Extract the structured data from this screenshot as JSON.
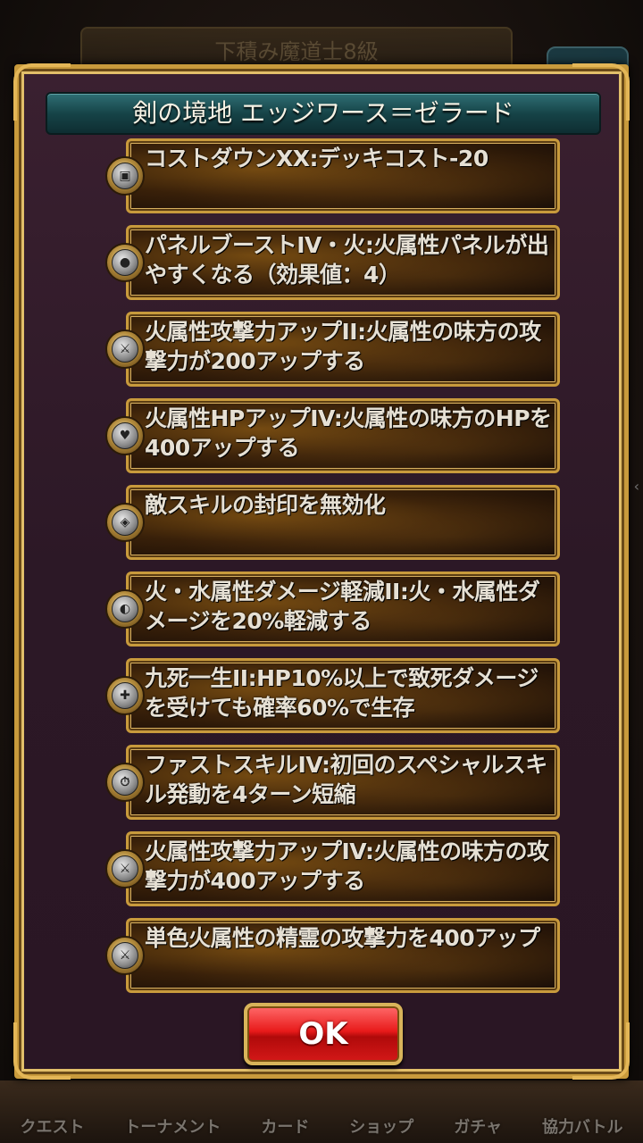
{
  "background": {
    "header_text": "下積み魔道士8級",
    "nav_items": [
      "クエスト",
      "トーナメント",
      "カード",
      "ショップ",
      "ガチャ",
      "協力バトル"
    ]
  },
  "modal": {
    "title": "剣の境地 エッジワース＝ゼラード",
    "skills": [
      {
        "text": "コストダウンXX:デッキコスト-20",
        "icon": "card-cost-icon"
      },
      {
        "text": "パネルブーストIV・火:火属性パネルが出やすくなる（効果値：4）",
        "icon": "panel-boost-icon"
      },
      {
        "text": "火属性攻撃力アップII:火属性の味方の攻撃力が200アップする",
        "icon": "sword-up-icon"
      },
      {
        "text": "火属性HPアップIV:火属性の味方のHPを400アップする",
        "icon": "heart-up-icon"
      },
      {
        "text": "敵スキルの封印を無効化",
        "icon": "seal-guard-icon"
      },
      {
        "text": "火・水属性ダメージ軽減II:火・水属性ダメージを20%軽減する",
        "icon": "shield-down-icon"
      },
      {
        "text": "九死一生II:HP10%以上で致死ダメージを受けても確率60%で生存",
        "icon": "survive-icon"
      },
      {
        "text": "ファストスキルIV:初回のスペシャルスキル発動を4ターン短縮",
        "icon": "fast-skill-icon"
      },
      {
        "text": "火属性攻撃力アップIV:火属性の味方の攻撃力が400アップする",
        "icon": "sword-up-icon"
      },
      {
        "text": "単色火属性の精霊の攻撃力を400アップ",
        "icon": "sword-up-icon"
      }
    ],
    "ok_label": "OK"
  },
  "colors": {
    "frame_gold": "#c89a3c",
    "title_teal": "#164448",
    "ok_red": "#e81a1a"
  }
}
